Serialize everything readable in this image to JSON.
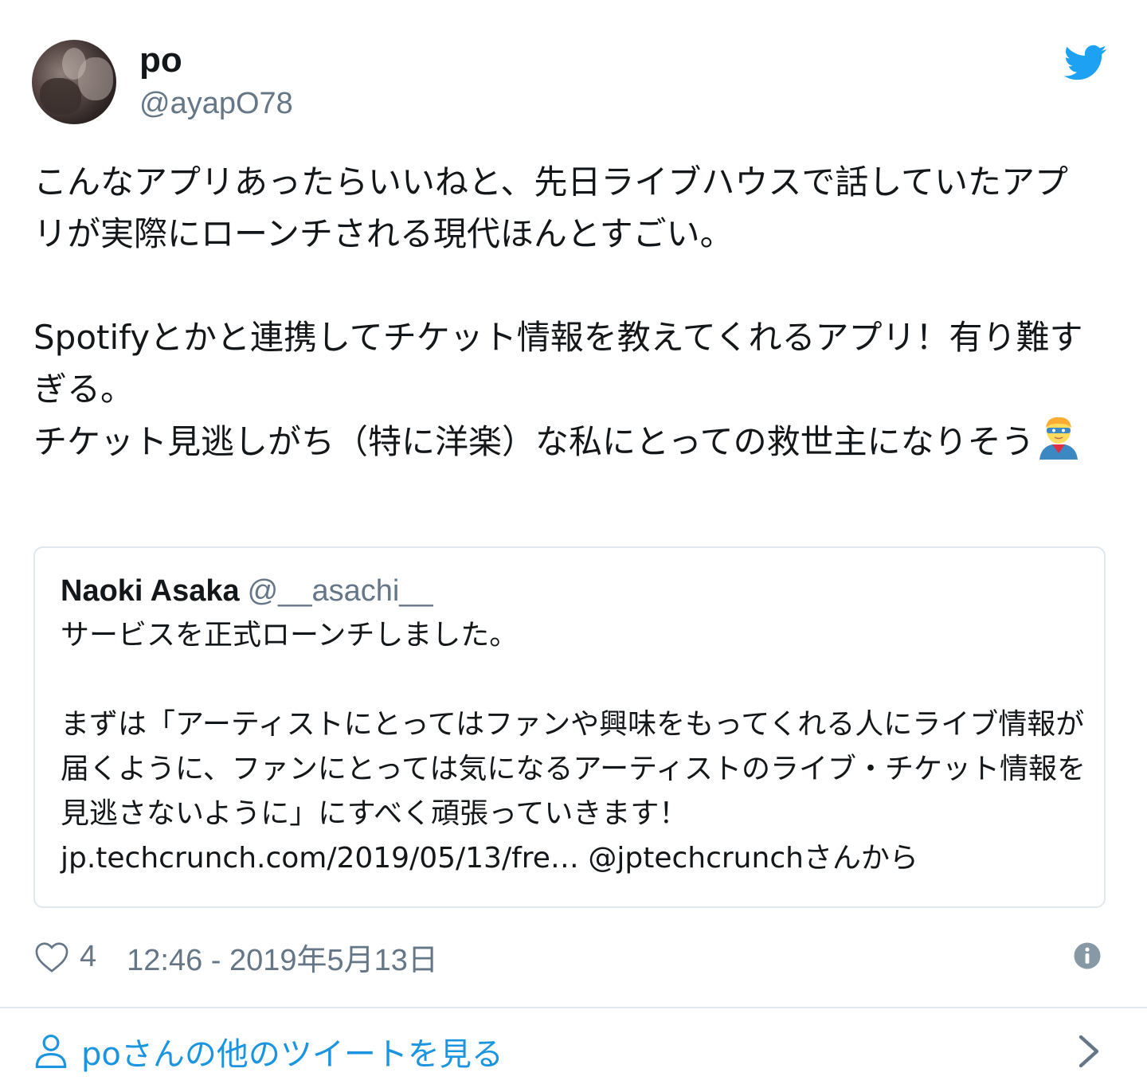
{
  "author": {
    "name": "po",
    "handle": "@ayapO78"
  },
  "tweet": {
    "text": "こんなアプリあったらいいねと、先日ライブハウスで話していたアプリが実際にローンチされる現代ほんとすごい。\n\nSpotifyとかと連携してチケット情報を教えてくれるアプリ！有り難すぎる。\nチケット見逃しがち（特に洋楽）な私にとっての救世主になりそう",
    "emoji": "superhero-emoji"
  },
  "quote": {
    "name": "Naoki Asaka",
    "handle": "@__asachi__",
    "text": "サービスを正式ローンチしました。\n\nまずは「アーティストにとってはファンや興味をもってくれる人にライブ情報が届くように、ファンにとっては気になるアーティストのライブ・チケット情報を見逃さないように」にすべく頑張っていきます！jp.techcrunch.com/2019/05/13/fre… @jptechcrunchさんから"
  },
  "footer": {
    "like_count": "4",
    "timestamp": "12:46 - 2019年5月13日",
    "more_link": "poさんの他のツイートを見る"
  },
  "colors": {
    "twitter_blue": "#1da1f2",
    "link_blue": "#1b95e0",
    "secondary_gray": "#657786",
    "border": "#e1e8ed"
  },
  "icons": [
    "twitter-bird-icon",
    "heart-icon",
    "info-icon",
    "person-icon",
    "chevron-right-icon"
  ]
}
